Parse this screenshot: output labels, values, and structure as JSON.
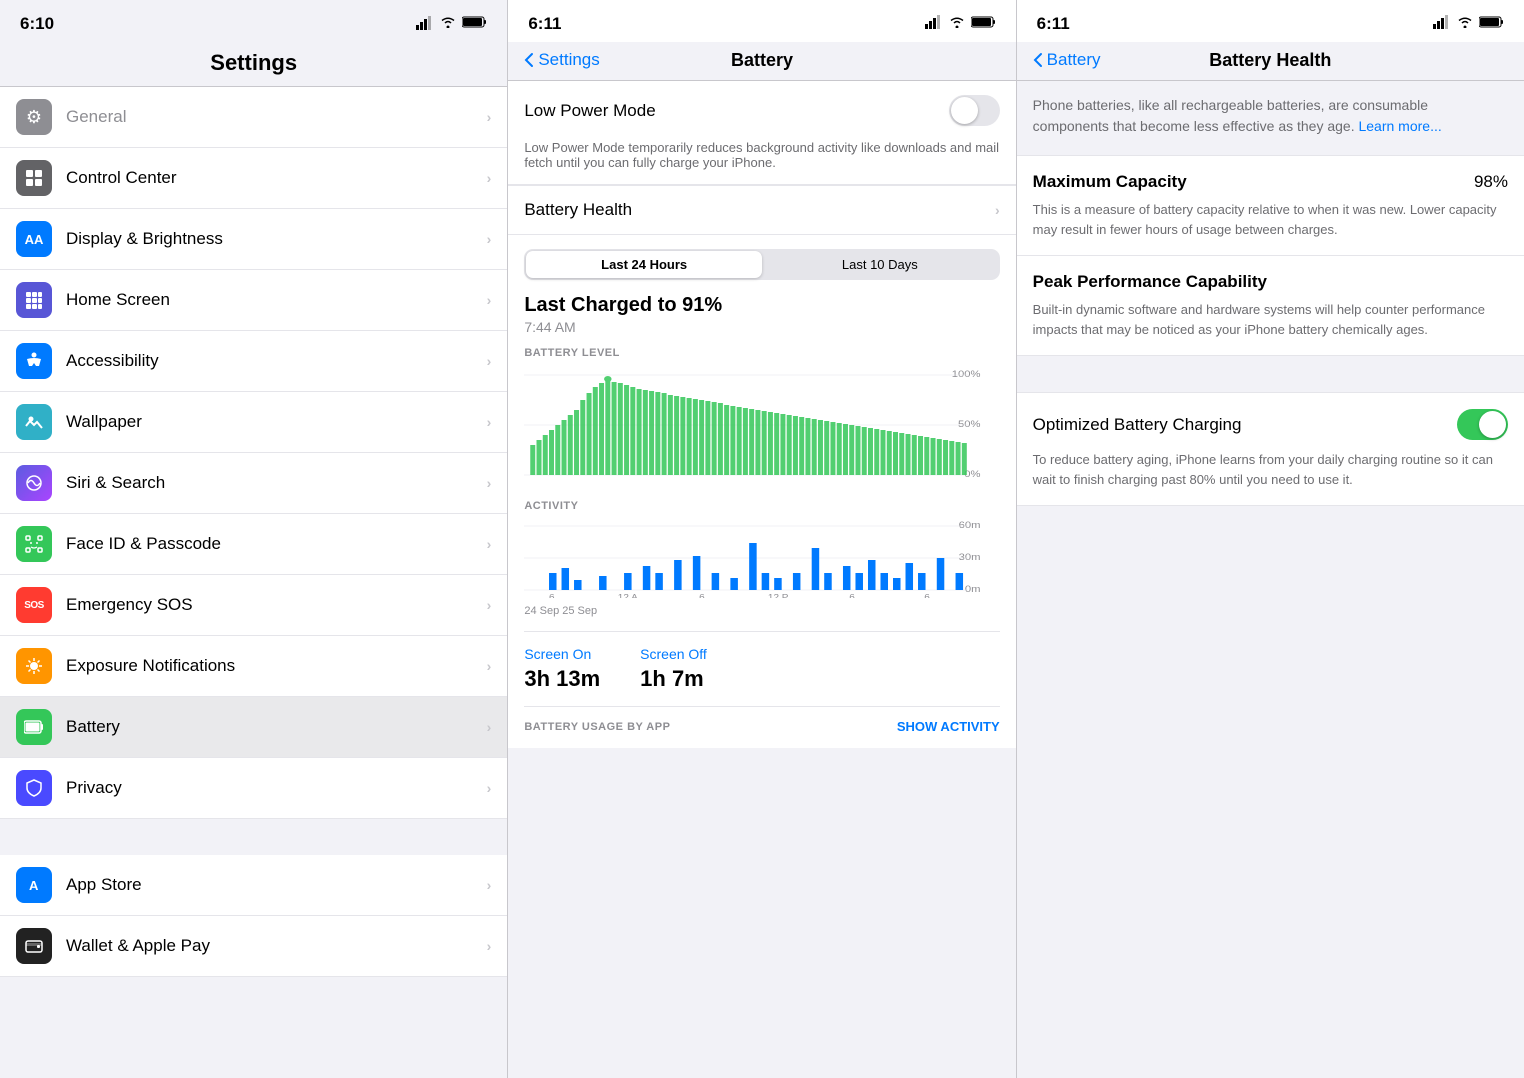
{
  "panel1": {
    "status": {
      "time": "6:10",
      "signal": "▂▄▆",
      "wifi": "wifi",
      "battery": "battery"
    },
    "title": "Settings",
    "items": [
      {
        "id": "general",
        "label": "General",
        "color": "#8e8e93",
        "icon": "⚙️",
        "bg": "#8e8e93"
      },
      {
        "id": "control-center",
        "label": "Control Center",
        "color": "#636366",
        "icon": "⊞",
        "bg": "#636366"
      },
      {
        "id": "display",
        "label": "Display & Brightness",
        "color": "#007aff",
        "icon": "AA",
        "bg": "#007aff"
      },
      {
        "id": "home-screen",
        "label": "Home Screen",
        "color": "#5856d6",
        "icon": "⠿",
        "bg": "#5856d6"
      },
      {
        "id": "accessibility",
        "label": "Accessibility",
        "color": "#007aff",
        "icon": "♿",
        "bg": "#007aff"
      },
      {
        "id": "wallpaper",
        "label": "Wallpaper",
        "color": "#30b0c7",
        "icon": "❀",
        "bg": "#30b0c7"
      },
      {
        "id": "siri",
        "label": "Siri & Search",
        "color": "#5c5ce0",
        "icon": "✦",
        "bg": "#5c5ce0"
      },
      {
        "id": "faceid",
        "label": "Face ID & Passcode",
        "color": "#34c759",
        "icon": "☻",
        "bg": "#34c759"
      },
      {
        "id": "sos",
        "label": "Emergency SOS",
        "color": "#ff3b30",
        "icon": "SOS",
        "bg": "#ff3b30"
      },
      {
        "id": "exposure",
        "label": "Exposure Notifications",
        "color": "#ff9500",
        "icon": "⊛",
        "bg": "#ff9500"
      },
      {
        "id": "battery",
        "label": "Battery",
        "color": "#34c759",
        "icon": "🔋",
        "bg": "#34c759",
        "active": true
      },
      {
        "id": "privacy",
        "label": "Privacy",
        "color": "#007aff",
        "icon": "✋",
        "bg": "#4a4aff"
      },
      {
        "id": "appstore",
        "label": "App Store",
        "color": "#007aff",
        "icon": "A",
        "bg": "#007aff"
      },
      {
        "id": "wallet",
        "label": "Wallet & Apple Pay",
        "color": "#000",
        "icon": "▤",
        "bg": "#222"
      }
    ]
  },
  "panel2": {
    "status": {
      "time": "6:11"
    },
    "nav": {
      "back_label": "Settings",
      "title": "Battery"
    },
    "low_power_mode": {
      "label": "Low Power Mode",
      "description": "Low Power Mode temporarily reduces background activity like downloads and mail fetch until you can fully charge your iPhone.",
      "enabled": false
    },
    "battery_health": {
      "label": "Battery Health",
      "chevron": "›"
    },
    "chart": {
      "last_charged": "Last Charged to 91%",
      "time": "7:44 AM",
      "battery_level_label": "BATTERY LEVEL",
      "activity_label": "ACTIVITY",
      "tab_24h": "Last 24 Hours",
      "tab_10d": "Last 10 Days",
      "y_axis_top": "100%",
      "y_axis_mid": "50%",
      "y_axis_bot": "0%",
      "act_y1": "60m",
      "act_y2": "30m",
      "act_y3": "0m",
      "x_label_date": "24 Sep  25 Sep",
      "screen_on_label": "Screen On",
      "screen_on_value": "3h 13m",
      "screen_off_label": "Screen Off",
      "screen_off_value": "1h 7m",
      "show_activity": "SHOW ACTIVITY",
      "battery_usage_label": "BATTERY USAGE BY APP"
    }
  },
  "panel3": {
    "status": {
      "time": "6:11"
    },
    "nav": {
      "back_label": "Battery",
      "title": "Battery Health"
    },
    "intro": "Phone batteries, like all rechargeable batteries, are consumable components that become less effective as they age.",
    "learn_more": "Learn more...",
    "max_capacity": {
      "title": "Maximum Capacity",
      "value": "98%",
      "description": "This is a measure of battery capacity relative to when it was new. Lower capacity may result in fewer hours of usage between charges."
    },
    "peak_performance": {
      "title": "Peak Performance Capability",
      "description": "Built-in dynamic software and hardware systems will help counter performance impacts that may be noticed as your iPhone battery chemically ages."
    },
    "optimized": {
      "title": "Optimized Battery Charging",
      "enabled": true,
      "description": "To reduce battery aging, iPhone learns from your daily charging routine so it can wait to finish charging past 80% until you need to use it."
    }
  }
}
